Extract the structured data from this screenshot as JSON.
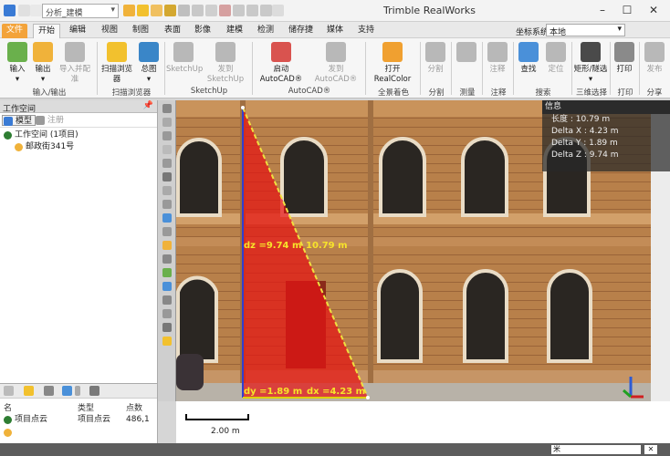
{
  "app": {
    "title": "Trimble RealWorks"
  },
  "toolbar": {
    "layout_value": "分析_建模"
  },
  "window": {
    "minimize": "–",
    "maximize": "☐",
    "close": "✕"
  },
  "tabs": [
    "文件",
    "开始",
    "编辑",
    "视图",
    "制图",
    "表面",
    "影像",
    "建模",
    "检测",
    "储存捷",
    "媒体",
    "支持"
  ],
  "coord": {
    "label": "坐标系统",
    "value": "本地"
  },
  "ribbon": {
    "buttons": [
      {
        "label": "输入",
        "sub": "▾",
        "color": "#6ab04c",
        "enabled": true
      },
      {
        "label": "输出",
        "sub": "▾",
        "color": "#f0b23a",
        "enabled": true
      },
      {
        "label": "导入并配准",
        "color": "#b8b8b8",
        "enabled": false
      },
      {
        "label": "扫描浏览器",
        "color": "#f2c12e",
        "enabled": true
      },
      {
        "label": "总图",
        "sub": "▾",
        "color": "#3a86c8",
        "enabled": true
      },
      {
        "label": "SketchUp",
        "color": "#b8b8b8",
        "enabled": false
      },
      {
        "label": "发到SketchUp",
        "color": "#b8b8b8",
        "enabled": false
      },
      {
        "label": "启动AutoCAD®",
        "color": "#d9534f",
        "enabled": true
      },
      {
        "label": "发到AutoCAD®",
        "color": "#b8b8b8",
        "enabled": false
      },
      {
        "label": "打开RealColor",
        "color": "#f0a030",
        "enabled": true
      },
      {
        "label": "分割",
        "color": "#b8b8b8",
        "enabled": false
      },
      {
        "label": "",
        "color": "#b8b8b8",
        "enabled": false
      },
      {
        "label": "注释",
        "color": "#b8b8b8",
        "enabled": false
      },
      {
        "label": "查找",
        "color": "#4a90d9",
        "enabled": true
      },
      {
        "label": "定位",
        "color": "#b8b8b8",
        "enabled": false
      },
      {
        "label": "矩形/隧选",
        "sub": "▾",
        "color": "#4a4a4a",
        "enabled": true
      },
      {
        "label": "打印",
        "color": "#8a8a8a",
        "enabled": true
      },
      {
        "label": "发布",
        "color": "#b8b8b8",
        "enabled": false
      }
    ],
    "groups": [
      "输入/输出",
      "扫描浏览器",
      "SketchUp",
      "AutoCAD®",
      "全景着色",
      "分割",
      "测量",
      "注释",
      "搜索",
      "三维选择",
      "打印",
      "分享"
    ]
  },
  "workspace": {
    "header": "工作空间",
    "pin": "📌",
    "tabs": [
      {
        "label": "模型",
        "color": "#3a7bd5"
      },
      {
        "label": "注册",
        "color": "#9a9a9a"
      }
    ],
    "tree": [
      {
        "label": "工作空间 (1项目)",
        "color": "#2e7d32"
      },
      {
        "label": "邮政街341号",
        "color": "#f0b23a"
      }
    ]
  },
  "bottom": {
    "headers": {
      "name": "名",
      "type": "类型",
      "count": "点数"
    },
    "rows": [
      {
        "name": "项目点云",
        "type": "项目点云",
        "count": "486,1",
        "color": "#2e7d32"
      },
      {
        "name": "",
        "type": "",
        "count": "",
        "color": "#f0b23a"
      }
    ]
  },
  "vtool_colors": [
    "#888",
    "#aaa",
    "#999",
    "#bbb",
    "#999",
    "#777",
    "#aaa",
    "#999",
    "#4a90d9",
    "#999",
    "#f0b23a",
    "#888",
    "#6ab04c",
    "#4a90d9",
    "#888",
    "#999",
    "#777",
    "#f2c12e"
  ],
  "measurement": {
    "dz_label": "dz =9.74 m",
    "dist_label": "10.79 m",
    "dy_label": "dy =1.89 m",
    "dx_label": "dx =4.23 m"
  },
  "info": {
    "title": "信息",
    "lines": [
      "长度 : 10.79 m",
      "Delta X : 4.23 m",
      "Delta Y : 1.89 m",
      "Delta Z : 9.74 m"
    ]
  },
  "scale": {
    "label": "2.00 m"
  },
  "status": {
    "unit": "米",
    "x": "✕"
  }
}
